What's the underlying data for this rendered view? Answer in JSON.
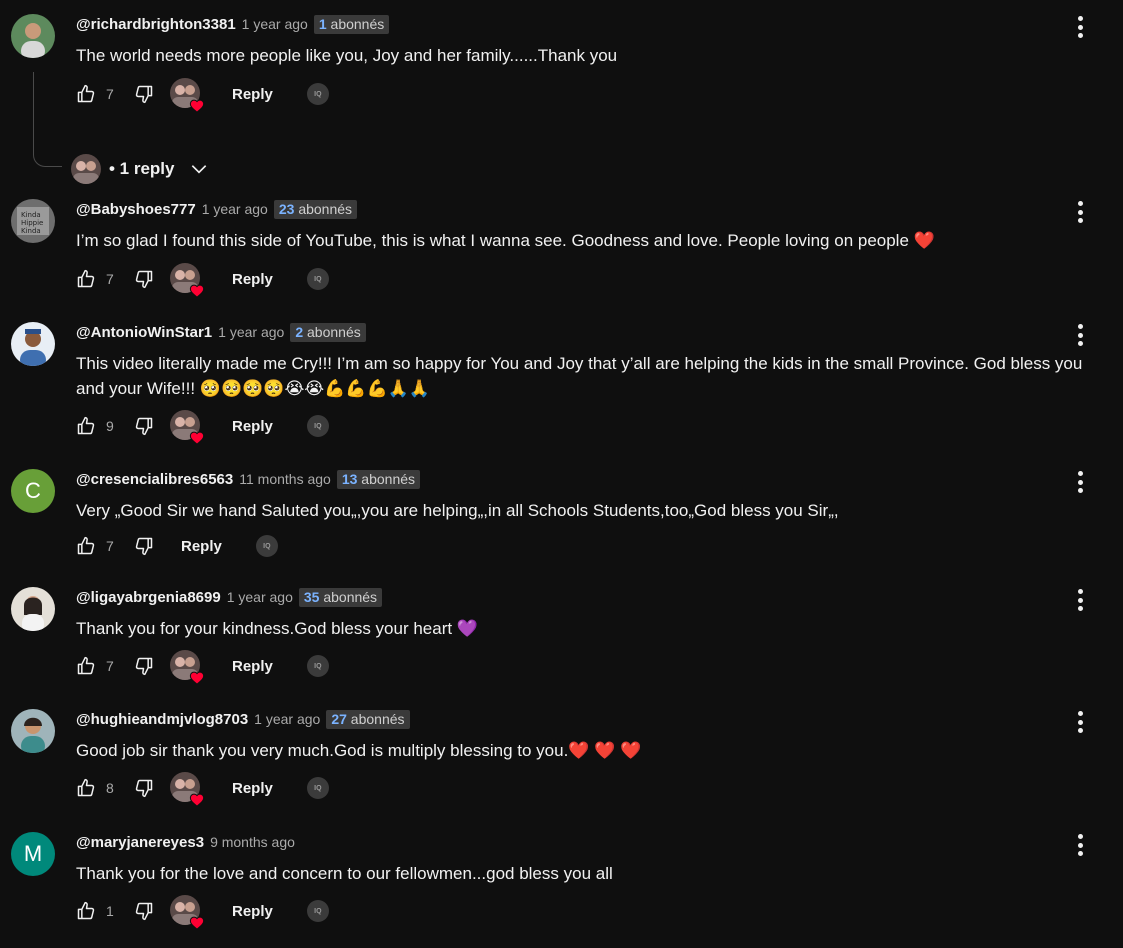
{
  "ui": {
    "reply_label": "Reply",
    "iq_label": "IQ"
  },
  "comments": [
    {
      "author": "@richardbrighton3381",
      "time": "1 year ago",
      "badge_num": "1",
      "badge_suffix": " abonnés",
      "text": "The world needs more people like you, Joy and her family......Thank you",
      "likes": "7",
      "avatar_initial": "",
      "avatar_color": "#6a8f6a",
      "replies_label": "• 1 reply"
    },
    {
      "author": "@Babyshoes777",
      "time": "1 year ago",
      "badge_num": "23",
      "badge_suffix": " abonnés",
      "text": "I’m so glad I found this side of YouTube, this is what I wanna see. Goodness and love. People loving on people ❤️",
      "likes": "7",
      "avatar_initial": "",
      "avatar_color": "#7a7a7a"
    },
    {
      "author": "@AntonioWinStar1",
      "time": "1 year ago",
      "badge_num": "2",
      "badge_suffix": " abonnés",
      "text": "This video literally made me Cry!!! I’m am so happy for You and Joy that y’all are helping the kids in the small Province. God bless you and your Wife!!! 🥺🥺🥺🥺😭😭💪💪💪🙏🙏",
      "likes": "9",
      "avatar_initial": "",
      "avatar_color": "#3f6fb0"
    },
    {
      "author": "@cresencialibres6563",
      "time": "11 months ago",
      "badge_num": "13",
      "badge_suffix": " abonnés",
      "text": "Very „Good Sir we hand Saluted you„,you are helping„,in all Schools Students,too„God bless you Sir„,",
      "likes": "7",
      "avatar_initial": "C",
      "avatar_color": "#689f38"
    },
    {
      "author": "@ligayabrgenia8699",
      "time": "1 year ago",
      "badge_num": "35",
      "badge_suffix": " abonnés",
      "text": "Thank you for your kindness.God bless your heart 💜",
      "likes": "7",
      "avatar_initial": "",
      "avatar_color": "#d9d4cc"
    },
    {
      "author": "@hughieandmjvlog8703",
      "time": "1 year ago",
      "badge_num": "27",
      "badge_suffix": " abonnés",
      "text": "Good job sir thank you very much.God is multiply blessing to you.❤️ ❤️ ❤️",
      "likes": "8",
      "avatar_initial": "",
      "avatar_color": "#8aa0a6"
    },
    {
      "author": "@maryjanereyes3",
      "time": "9 months ago",
      "text": "Thank you for the  love and concern to our fellowmen...god bless you all",
      "likes": "1",
      "avatar_initial": "M",
      "avatar_color": "#00897b"
    }
  ]
}
